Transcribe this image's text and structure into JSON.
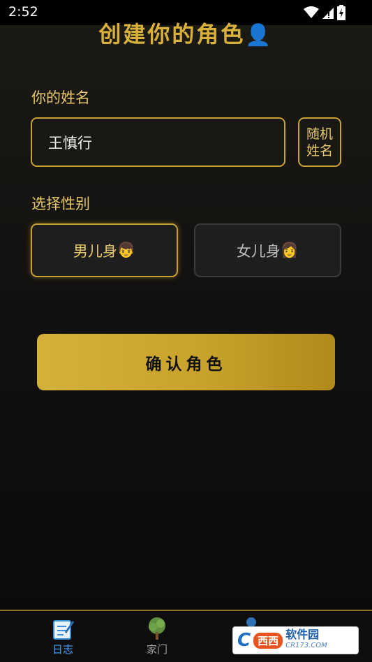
{
  "status_bar": {
    "time": "2:52",
    "icons": [
      "wifi-icon",
      "signal-icon",
      "battery-icon"
    ]
  },
  "header": {
    "title": "创建你的角色",
    "title_emoji": "👤"
  },
  "name_section": {
    "label": "你的姓名",
    "value": "王慎行",
    "random_button_line1": "随机",
    "random_button_line2": "姓名"
  },
  "gender_section": {
    "label": "选择性别",
    "male_label": "男儿身",
    "male_emoji": "👦",
    "female_label": "女儿身",
    "female_emoji": "👩",
    "selected": "male"
  },
  "confirm_button": {
    "label": "确认角色"
  },
  "bottom_nav": {
    "items": [
      {
        "label": "日志",
        "icon": "diary-icon",
        "active": true
      },
      {
        "label": "家门",
        "icon": "tree-icon",
        "active": false
      },
      {
        "label": "",
        "icon": "person-icon",
        "active": false
      }
    ]
  },
  "watermark": {
    "brand": "西西软件园",
    "url": "CR173.COM"
  },
  "colors": {
    "accent": "#d9b13a",
    "active_nav": "#4aa8ff",
    "inactive_nav": "#a0a0a0"
  }
}
